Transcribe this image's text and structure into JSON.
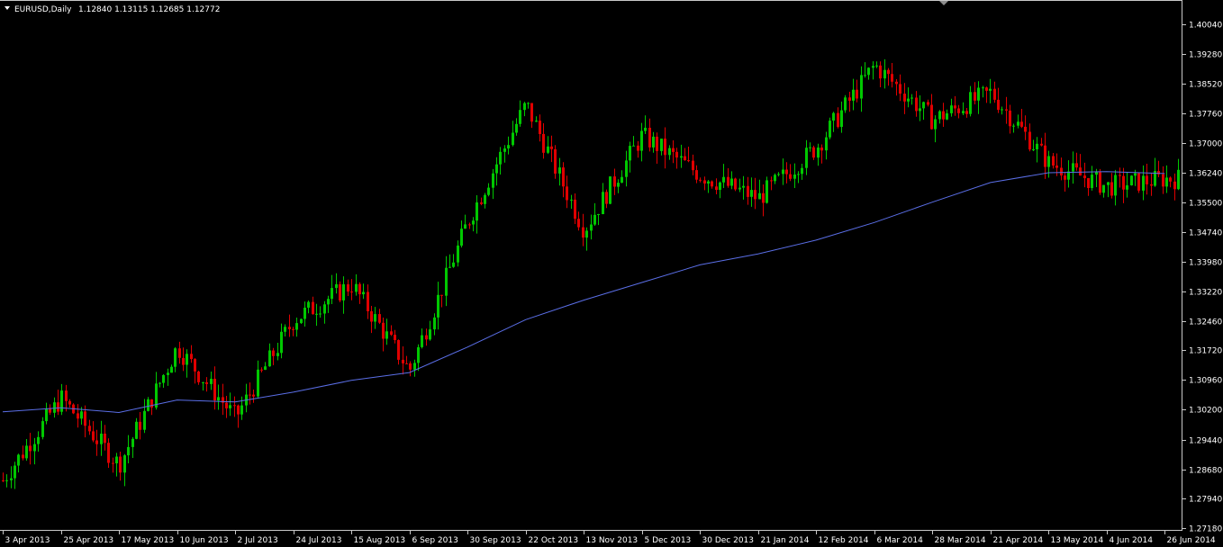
{
  "header": {
    "symbol_label": "EURUSD,Daily",
    "ohlc_label": "1.12840 1.13115 1.12685 1.12772"
  },
  "colors": {
    "background": "#000000",
    "up_candle": "#00c800",
    "down_candle": "#e00000",
    "moving_average": "#5a6ee6",
    "axis": "#c8c8c8",
    "text": "#ffffff"
  },
  "chart_data": {
    "type": "line",
    "title": "",
    "symbol": "EURUSD",
    "timeframe": "Daily",
    "price_axis_ticks": [
      "1.40040",
      "1.39280",
      "1.38520",
      "1.37760",
      "1.37000",
      "1.36240",
      "1.35500",
      "1.34740",
      "1.33980",
      "1.33220",
      "1.32460",
      "1.31720",
      "1.30960",
      "1.30200",
      "1.29440",
      "1.28680",
      "1.27940",
      "1.27180"
    ],
    "date_axis_labels": [
      "3 Apr 2013",
      "25 Apr 2013",
      "17 May 2013",
      "10 Jun 2013",
      "2 Jul 2013",
      "24 Jul 2013",
      "15 Aug 2013",
      "6 Sep 2013",
      "30 Sep 2013",
      "22 Oct 2013",
      "13 Nov 2013",
      "5 Dec 2013",
      "30 Dec 2013",
      "21 Jan 2014",
      "12 Feb 2014",
      "6 Mar 2014",
      "28 Mar 2014",
      "21 Apr 2014",
      "13 May 2014",
      "4 Jun 2014",
      "26 Jun 2014"
    ],
    "ylim": [
      1.2718,
      1.4004
    ],
    "price_series_name": "EURUSD daily close (candles)",
    "price_series": {
      "x": [
        "3 Apr 2013",
        "25 Apr 2013",
        "17 May 2013",
        "10 Jun 2013",
        "2 Jul 2013",
        "24 Jul 2013",
        "15 Aug 2013",
        "6 Sep 2013",
        "30 Sep 2013",
        "22 Oct 2013",
        "13 Nov 2013",
        "5 Dec 2013",
        "30 Dec 2013",
        "21 Jan 2014",
        "12 Feb 2014",
        "6 Mar 2014",
        "28 Mar 2014",
        "21 Apr 2014",
        "13 May 2014",
        "4 Jun 2014",
        "26 Jun 2014"
      ],
      "close": [
        1.284,
        1.305,
        1.288,
        1.318,
        1.3,
        1.325,
        1.334,
        1.312,
        1.35,
        1.38,
        1.348,
        1.372,
        1.362,
        1.356,
        1.369,
        1.39,
        1.376,
        1.383,
        1.365,
        1.359,
        1.361
      ]
    },
    "moving_average": {
      "x": [
        "3 Apr 2013",
        "25 Apr 2013",
        "17 May 2013",
        "10 Jun 2013",
        "2 Jul 2013",
        "24 Jul 2013",
        "15 Aug 2013",
        "6 Sep 2013",
        "30 Sep 2013",
        "22 Oct 2013",
        "13 Nov 2013",
        "5 Dec 2013",
        "30 Dec 2013",
        "21 Jan 2014",
        "12 Feb 2014",
        "6 Mar 2014",
        "28 Mar 2014",
        "21 Apr 2014",
        "13 May 2014",
        "4 Jun 2014",
        "26 Jun 2014"
      ],
      "values": [
        1.3015,
        1.3025,
        1.3013,
        1.3045,
        1.304,
        1.3065,
        1.3095,
        1.3115,
        1.318,
        1.325,
        1.33,
        1.3345,
        1.339,
        1.3418,
        1.3453,
        1.3498,
        1.355,
        1.36,
        1.3625,
        1.3628,
        1.3623
      ]
    },
    "grid": false,
    "legend": "none"
  }
}
